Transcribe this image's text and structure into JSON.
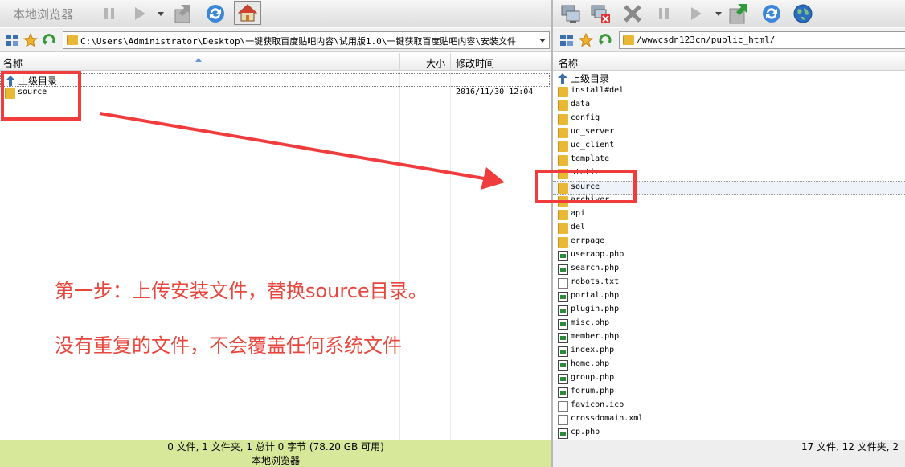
{
  "left_pane": {
    "title": "本地浏览器",
    "address": "C:\\Users\\Administrator\\Desktop\\一键获取百度贴吧内容\\试用版1.0\\一键获取百度贴吧内容\\安装文件",
    "columns": {
      "name": "名称",
      "size": "大小",
      "modified": "修改时间"
    },
    "up_dir": "上级目录",
    "files": [
      {
        "name": "source",
        "type": "folder",
        "modified": "2016/11/30 12:04"
      }
    ],
    "status": "0 文件, 1 文件夹, 1 总计 0 字节 (78.20 GB 可用)",
    "status_title": "本地浏览器",
    "status_color": "#d8e89a"
  },
  "right_pane": {
    "address": "/wwwcsdn123cn/public_html/",
    "columns": {
      "name": "名称"
    },
    "up_dir": "上级目录",
    "files": [
      {
        "name": "install#del",
        "type": "folder"
      },
      {
        "name": "data",
        "type": "folder"
      },
      {
        "name": "config",
        "type": "folder"
      },
      {
        "name": "uc_server",
        "type": "folder"
      },
      {
        "name": "uc_client",
        "type": "folder"
      },
      {
        "name": "template",
        "type": "folder"
      },
      {
        "name": "static",
        "type": "folder"
      },
      {
        "name": "source",
        "type": "folder"
      },
      {
        "name": "archiver",
        "type": "folder"
      },
      {
        "name": "api",
        "type": "folder"
      },
      {
        "name": "del",
        "type": "folder"
      },
      {
        "name": "errpage",
        "type": "folder"
      },
      {
        "name": "userapp.php",
        "type": "php"
      },
      {
        "name": "search.php",
        "type": "php"
      },
      {
        "name": "robots.txt",
        "type": "doc"
      },
      {
        "name": "portal.php",
        "type": "php"
      },
      {
        "name": "plugin.php",
        "type": "php"
      },
      {
        "name": "misc.php",
        "type": "php"
      },
      {
        "name": "member.php",
        "type": "php"
      },
      {
        "name": "index.php",
        "type": "php"
      },
      {
        "name": "home.php",
        "type": "php"
      },
      {
        "name": "group.php",
        "type": "php"
      },
      {
        "name": "forum.php",
        "type": "php"
      },
      {
        "name": "favicon.ico",
        "type": "doc"
      },
      {
        "name": "crossdomain.xml",
        "type": "doc"
      },
      {
        "name": "cp.php",
        "type": "php"
      }
    ],
    "status": "17 文件, 12 文件夹, 2"
  },
  "annotation": {
    "line1": "第一步：上传安装文件，替换source目录。",
    "line2": "没有重复的文件，不会覆盖任何系统文件",
    "color": "#e8453c"
  },
  "icons": {
    "toolbar_left": [
      "pause-icon",
      "play-icon",
      "dropdown-arrow-icon",
      "transfer-icon",
      "refresh-icon",
      "home-icon"
    ],
    "toolbar_right": [
      "connect-icon",
      "disconnect-icon",
      "stop-icon",
      "pause-icon",
      "play-icon",
      "dropdown-arrow-icon",
      "transfer-icon",
      "refresh-icon",
      "globe-icon"
    ]
  }
}
